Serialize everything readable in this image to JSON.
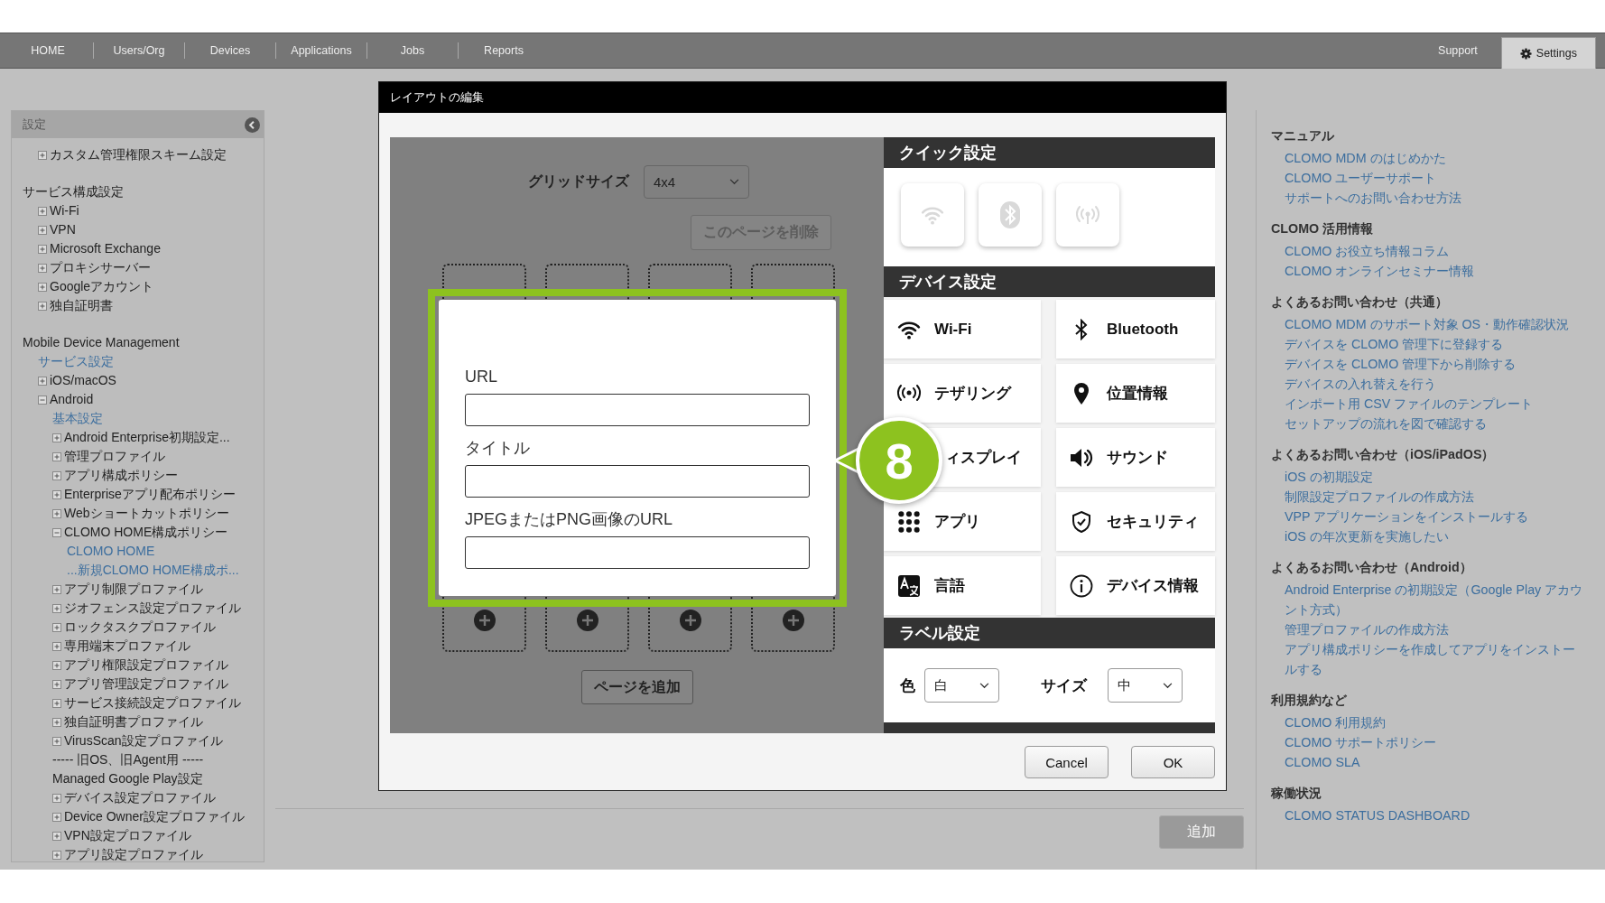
{
  "nav": {
    "items": [
      {
        "label": "HOME",
        "selected": false
      },
      {
        "label": "Users/Org",
        "selected": false
      },
      {
        "label": "Devices",
        "selected": false
      },
      {
        "label": "Applications",
        "selected": false
      },
      {
        "label": "Jobs",
        "selected": false
      },
      {
        "label": "Reports",
        "selected": false
      }
    ],
    "right_items": [
      {
        "label": "Support",
        "selected": false,
        "kind": "plain"
      },
      {
        "label": "Settings",
        "selected": true,
        "kind": "settings"
      }
    ]
  },
  "sidebar": {
    "title": "設定",
    "items": [
      {
        "kind": "group",
        "children": [
          {
            "kind": "node",
            "label": "カスタム管理権限スキーム設定",
            "expanded": false
          }
        ]
      },
      {
        "kind": "group",
        "label": "サービス構成設定",
        "children": [
          {
            "kind": "node",
            "label": "Wi-Fi",
            "expanded": false
          },
          {
            "kind": "node",
            "label": "VPN",
            "expanded": false
          },
          {
            "kind": "node",
            "label": "Microsoft Exchange",
            "expanded": false
          },
          {
            "kind": "node",
            "label": "プロキシサーバー",
            "expanded": false
          },
          {
            "kind": "node",
            "label": "Googleアカウント",
            "expanded": false
          },
          {
            "kind": "node",
            "label": "独自証明書",
            "expanded": false
          }
        ]
      },
      {
        "kind": "group",
        "label": "Mobile Device Management",
        "children": [
          {
            "kind": "link",
            "label": "サービス設定"
          },
          {
            "kind": "node",
            "label": "iOS/macOS",
            "expanded": false
          },
          {
            "kind": "node",
            "label": "Android",
            "expanded": true,
            "children": [
              {
                "kind": "link",
                "label": "基本設定"
              },
              {
                "kind": "node",
                "label": "Android Enterprise初期設定...",
                "expanded": false
              },
              {
                "kind": "node",
                "label": "管理プロファイル",
                "expanded": false
              },
              {
                "kind": "node",
                "label": "アプリ構成ポリシー",
                "expanded": false
              },
              {
                "kind": "node",
                "label": "Enterpriseアプリ配布ポリシー",
                "expanded": false
              },
              {
                "kind": "node",
                "label": "Webショートカットポリシー",
                "expanded": false
              },
              {
                "kind": "node",
                "label": "CLOMO HOME構成ポリシー",
                "expanded": true,
                "children": [
                  {
                    "kind": "link",
                    "label": "CLOMO HOME"
                  },
                  {
                    "kind": "link",
                    "label": "...新規CLOMO HOME構成ポ..."
                  }
                ]
              },
              {
                "kind": "node",
                "label": "アプリ制限プロファイル",
                "expanded": false
              },
              {
                "kind": "node",
                "label": "ジオフェンス設定プロファイル",
                "expanded": false
              },
              {
                "kind": "node",
                "label": "ロックタスクプロファイル",
                "expanded": false
              },
              {
                "kind": "node",
                "label": "専用端末プロファイル",
                "expanded": false
              },
              {
                "kind": "node",
                "label": "アプリ権限設定プロファイル",
                "expanded": false
              },
              {
                "kind": "node",
                "label": "アプリ管理設定プロファイル",
                "expanded": false
              },
              {
                "kind": "node",
                "label": "サービス接続設定プロファイル",
                "expanded": false
              },
              {
                "kind": "node",
                "label": "独自証明書プロファイル",
                "expanded": false
              },
              {
                "kind": "node",
                "label": "VirusScan設定プロファイル",
                "expanded": false
              },
              {
                "kind": "text",
                "label": "----- 旧OS、旧Agent用 -----"
              },
              {
                "kind": "text",
                "label": "Managed Google Play設定"
              },
              {
                "kind": "node",
                "label": "デバイス設定プロファイル",
                "expanded": false
              },
              {
                "kind": "node",
                "label": "Device Owner設定プロファイル",
                "expanded": false
              },
              {
                "kind": "node",
                "label": "VPN設定プロファイル",
                "expanded": false
              },
              {
                "kind": "node",
                "label": "アプリ設定プロファイル",
                "expanded": false
              }
            ]
          }
        ]
      }
    ]
  },
  "add_button": {
    "label": "追加",
    "disabled": true
  },
  "help": [
    {
      "heading": "マニュアル",
      "links": [
        "CLOMO MDM のはじめかた",
        "CLOMO ユーザーサポート",
        "サポートへのお問い合わせ方法"
      ]
    },
    {
      "heading": "CLOMO 活用情報",
      "links": [
        "CLOMO お役立ち情報コラム",
        "CLOMO オンラインセミナー情報"
      ]
    },
    {
      "heading": "よくあるお問い合わせ（共通）",
      "links": [
        "CLOMO MDM のサポート対象 OS・動作確認状況",
        "デバイスを CLOMO 管理下に登録する",
        "デバイスを CLOMO 管理下から削除する",
        "デバイスの入れ替えを行う",
        "インポート用 CSV ファイルのテンプレート",
        "セットアップの流れを図で確認する"
      ]
    },
    {
      "heading": "よくあるお問い合わせ（iOS/iPadOS）",
      "links": [
        "iOS の初期設定",
        "制限設定プロファイルの作成方法",
        "VPP アプリケーションをインストールする",
        "iOS の年次更新を実施したい"
      ]
    },
    {
      "heading": "よくあるお問い合わせ（Android）",
      "links": [
        "Android Enterprise の初期設定（Google Play アカウント方式）",
        "管理プロファイルの作成方法",
        "アプリ構成ポリシーを作成してアプリをインストールする"
      ]
    },
    {
      "heading": "利用規約など",
      "links": [
        "CLOMO 利用規約",
        "CLOMO サポートポリシー",
        "CLOMO SLA"
      ]
    },
    {
      "heading": "稼働状況",
      "links": [
        "CLOMO STATUS DASHBOARD"
      ]
    }
  ],
  "dialog": {
    "title": "レイアウトの編集",
    "grid_size": {
      "label": "グリッドサイズ",
      "value": "4x4"
    },
    "delete_page": {
      "label": "このページを削除",
      "disabled": true
    },
    "add_page": "ページを追加",
    "popup": {
      "fields": [
        {
          "label": "URL"
        },
        {
          "label": "タイトル"
        },
        {
          "label": "JPEGまたはPNG画像のURL"
        }
      ]
    },
    "step": "8",
    "quick_settings": {
      "title": "クイック設定",
      "tiles": [
        {
          "kind": "wifi"
        },
        {
          "kind": "bluetooth"
        },
        {
          "kind": "tethering"
        }
      ]
    },
    "device_settings": {
      "title": "デバイス設定",
      "items": [
        {
          "kind": "wifi",
          "label": "Wi-Fi"
        },
        {
          "kind": "bluetooth",
          "label": "Bluetooth"
        },
        {
          "kind": "tethering",
          "label": "テザリング"
        },
        {
          "kind": "location",
          "label": "位置情報"
        },
        {
          "kind": "display",
          "label": "ィスプレイ"
        },
        {
          "kind": "sound",
          "label": "サウンド"
        },
        {
          "kind": "apps",
          "label": "アプリ"
        },
        {
          "kind": "security",
          "label": "セキュリティ"
        },
        {
          "kind": "language",
          "label": "言語"
        },
        {
          "kind": "info",
          "label": "デバイス情報"
        }
      ]
    },
    "label_settings": {
      "title": "ラベル設定",
      "color_label": "色",
      "color_value": "白",
      "size_label": "サイズ",
      "size_value": "中"
    },
    "buttons": [
      "Cancel",
      "OK"
    ]
  }
}
